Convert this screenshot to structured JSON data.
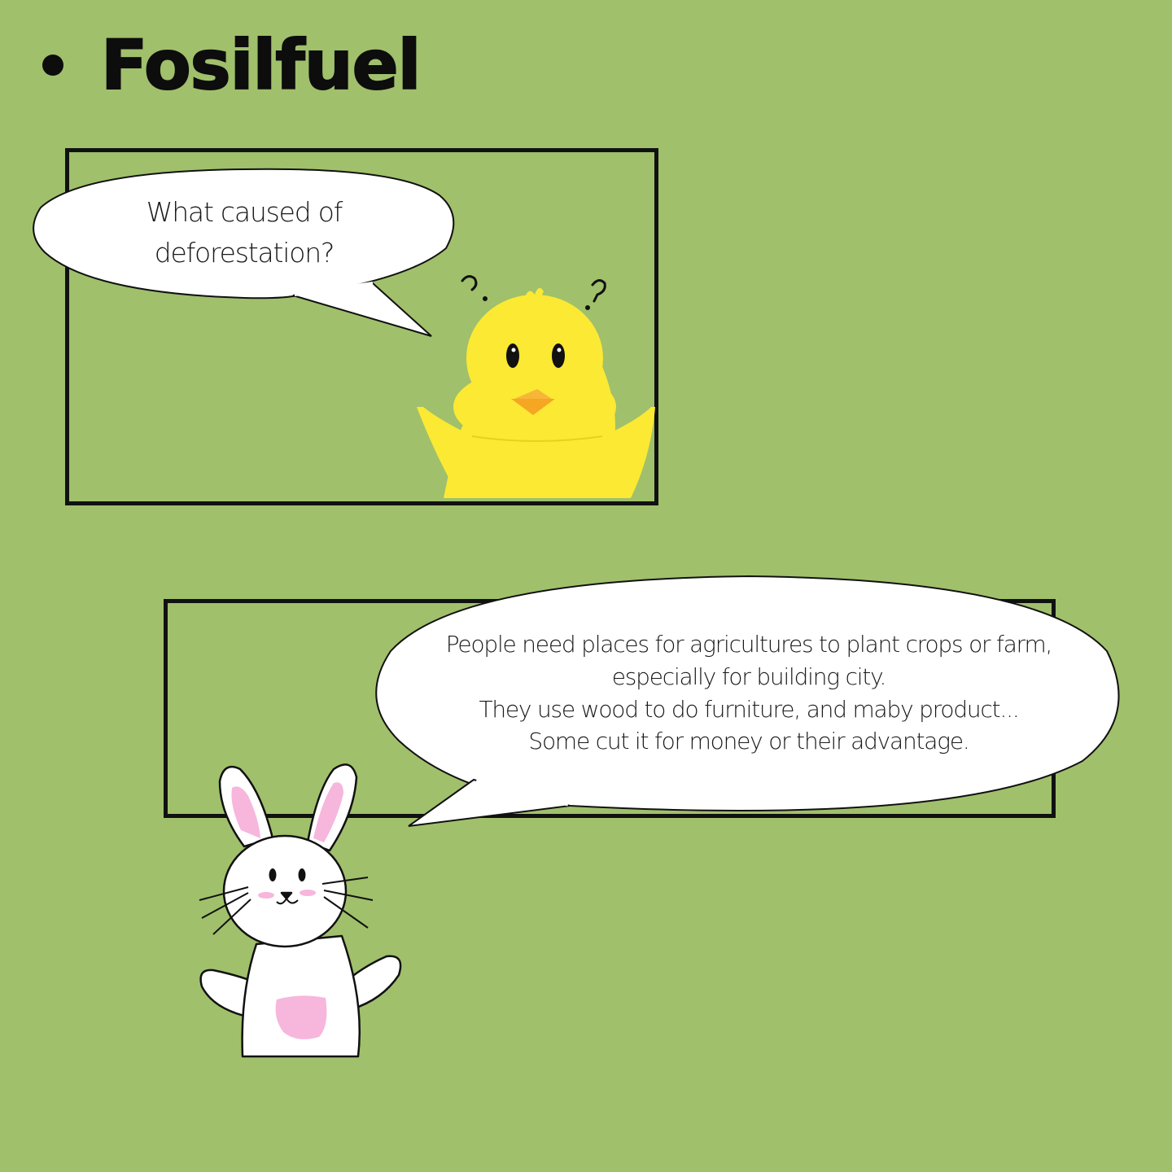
{
  "heading": {
    "title": "Fosilfuel"
  },
  "panel_top": {
    "speech": {
      "lines": [
        "What caused of",
        "deforestation?"
      ]
    },
    "character": "chick",
    "marks": [
      "?",
      "?"
    ]
  },
  "panel_bottom": {
    "speech": {
      "lines": [
        "People need places for agricultures to plant crops or farm,",
        "especially for building city.",
        "They use wood to do furniture, and maby product...",
        "Some cut it for money or their advantage."
      ]
    },
    "character": "bunny"
  },
  "colors": {
    "background": "#a0c06b",
    "chick": "#fbe933",
    "beak": "#f5a623",
    "bunny_pink": "#f7b6dc"
  }
}
